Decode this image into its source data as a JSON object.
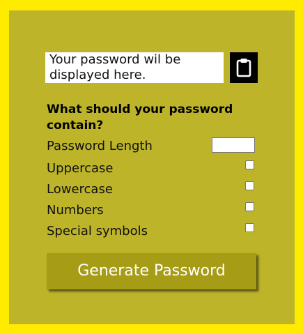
{
  "output": {
    "placeholder": "Your password wil be displayed here."
  },
  "copy_button": {
    "icon": "clipboard-icon"
  },
  "options": {
    "heading": "What should your password contain?",
    "length_label": "Password Length",
    "length_value": "",
    "uppercase_label": "Uppercase",
    "uppercase_checked": false,
    "lowercase_label": "Lowercase",
    "lowercase_checked": false,
    "numbers_label": "Numbers",
    "numbers_checked": false,
    "symbols_label": "Special symbols",
    "symbols_checked": false
  },
  "generate_button": {
    "label": "Generate Password"
  },
  "colors": {
    "outer_frame": "#ffeb00",
    "panel": "#bdb42a",
    "button": "#a69c16",
    "copy_button": "#000000"
  }
}
